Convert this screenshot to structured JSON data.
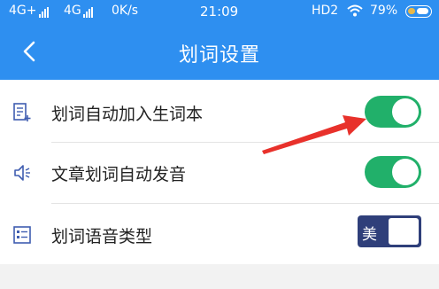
{
  "status_bar": {
    "network1": "4G+",
    "network2": "4G",
    "speed": "0K/s",
    "time": "21:09",
    "hd": "HD2",
    "battery": "79%"
  },
  "app_bar": {
    "title": "划词设置",
    "back_icon": "chevron-left-icon"
  },
  "settings": [
    {
      "label": "划词自动加入生词本",
      "icon": "add-note-icon",
      "enabled": true
    },
    {
      "label": "文章划词自动发音",
      "icon": "speaker-icon",
      "enabled": true
    },
    {
      "label": "划词语音类型",
      "icon": "list-icon",
      "value": "美"
    }
  ],
  "colors": {
    "accent": "#2e8ff0",
    "toggle_on": "#21b06a",
    "voice_select": "#2f3f7a",
    "annotation_arrow": "#e8312b"
  }
}
